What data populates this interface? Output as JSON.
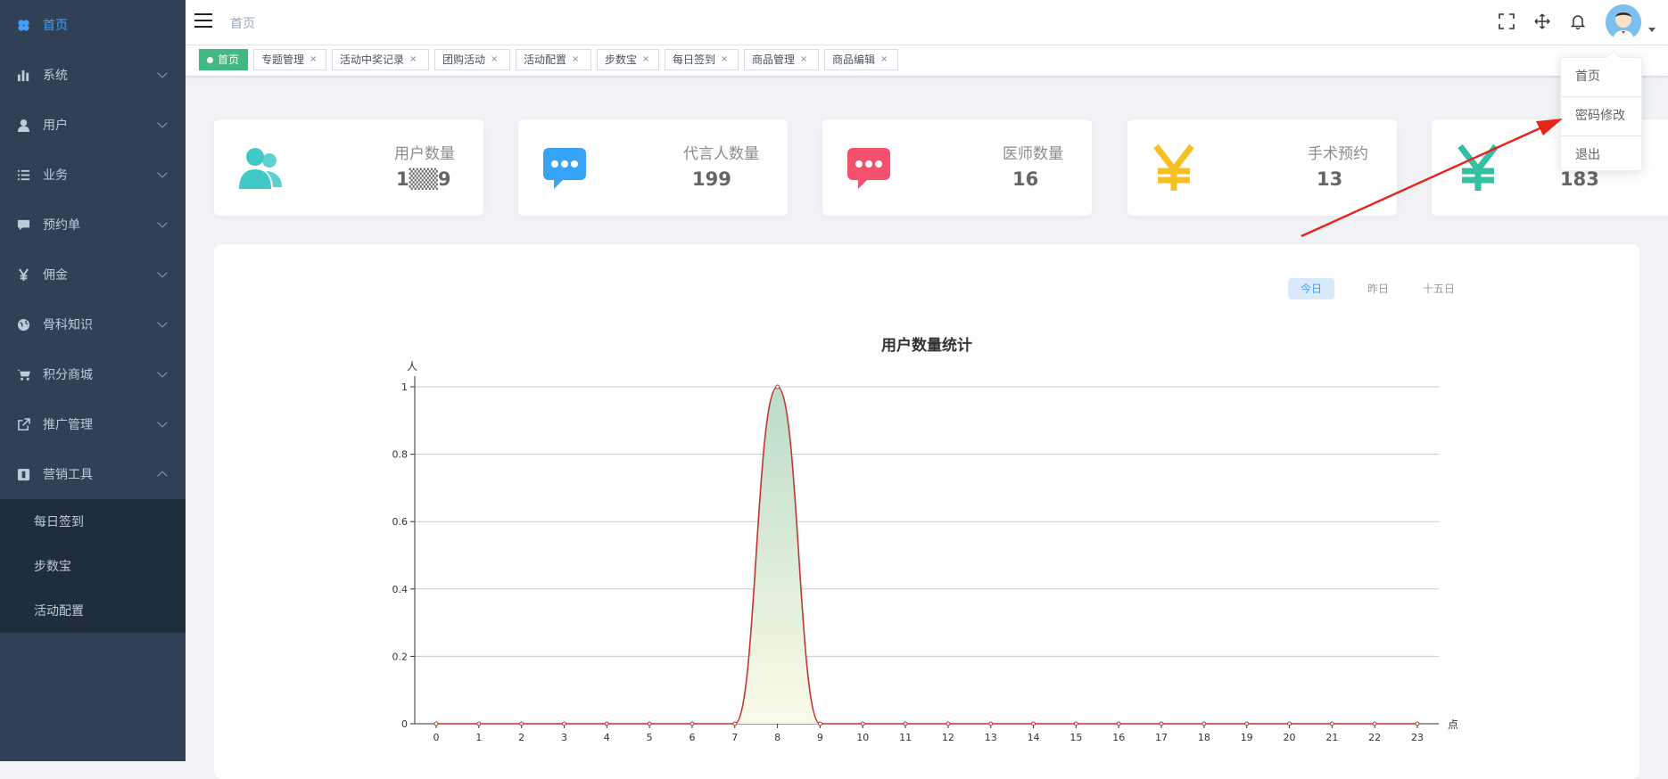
{
  "sidebar": {
    "items": [
      {
        "label": "首页",
        "icon": "dashboard-icon"
      },
      {
        "label": "系统",
        "icon": "bar-chart-icon"
      },
      {
        "label": "用户",
        "icon": "user-icon"
      },
      {
        "label": "业务",
        "icon": "list-icon"
      },
      {
        "label": "预约单",
        "icon": "chat-icon"
      },
      {
        "label": "佣金",
        "icon": "yen-icon"
      },
      {
        "label": "骨科知识",
        "icon": "globe-icon"
      },
      {
        "label": "积分商城",
        "icon": "cart-icon"
      },
      {
        "label": "推广管理",
        "icon": "external-link-icon"
      },
      {
        "label": "营销工具",
        "icon": "tool-icon"
      }
    ],
    "submenu": [
      "每日签到",
      "步数宝",
      "活动配置"
    ]
  },
  "header": {
    "breadcrumb": "首页",
    "icons": [
      "fullscreen-icon",
      "move-icon",
      "bell-icon"
    ]
  },
  "tags": [
    {
      "label": "首页",
      "active": true
    },
    {
      "label": "专题管理"
    },
    {
      "label": "活动中奖记录"
    },
    {
      "label": "团购活动"
    },
    {
      "label": "活动配置"
    },
    {
      "label": "步数宝"
    },
    {
      "label": "每日签到"
    },
    {
      "label": "商品管理"
    },
    {
      "label": "商品编辑"
    }
  ],
  "tag_close": "×",
  "cards": [
    {
      "label": "用户数量",
      "value": "1▒▒9",
      "icon": "users-icon",
      "color": "#40c9c6"
    },
    {
      "label": "代言人数量",
      "value": "199",
      "icon": "message-icon",
      "color": "#36a3f7"
    },
    {
      "label": "医师数量",
      "value": "16",
      "icon": "message-icon",
      "color": "#f4516c"
    },
    {
      "label": "手术预约",
      "value": "13",
      "icon": "yen-icon",
      "color": "#f6c022"
    },
    {
      "label": "",
      "value": "183",
      "icon": "yen-icon",
      "color": "#34bfa3"
    }
  ],
  "range_tabs": [
    "今日",
    "昨日",
    "十五日"
  ],
  "dropdown": [
    "首页",
    "密码修改",
    "退出"
  ],
  "chart_data": {
    "type": "area",
    "title": "用户数量统计",
    "ylabel": "人",
    "xlabel": "点",
    "x": [
      "0",
      "1",
      "2",
      "3",
      "4",
      "5",
      "6",
      "7",
      "8",
      "9",
      "10",
      "11",
      "12",
      "13",
      "14",
      "15",
      "16",
      "17",
      "18",
      "19",
      "20",
      "21",
      "22",
      "23"
    ],
    "series": [
      {
        "values": [
          0,
          0,
          0,
          0,
          0,
          0,
          0,
          0,
          1,
          0,
          0,
          0,
          0,
          0,
          0,
          0,
          0,
          0,
          0,
          0,
          0,
          0,
          0,
          0
        ]
      }
    ],
    "ylim": [
      0,
      1
    ],
    "yticks": [
      "0",
      "0.2",
      "0.4",
      "0.6",
      "0.8",
      "1"
    ],
    "grid": true,
    "line_color": "#c23531"
  }
}
